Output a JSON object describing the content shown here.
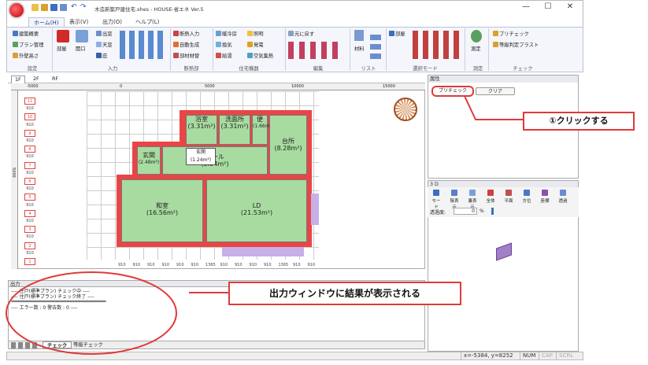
{
  "app": {
    "title": "木造新築戸建住宅.shes - HOUSE-省エネ Ver.5"
  },
  "window": {
    "minimize": "—",
    "maximize": "☐",
    "close": "✕"
  },
  "ribbon_tabs": [
    "ホーム(H)",
    "表示(V)",
    "出力(O)",
    "ヘルプ(L)"
  ],
  "ribbon": {
    "settings": {
      "label": "設定",
      "items": [
        "建築概要",
        "プラン管理",
        "外壁高さ"
      ]
    },
    "input": {
      "label": "入力",
      "room": "部屋",
      "opening": "開口",
      "col": [
        "出窓",
        "天窓",
        "庇"
      ]
    },
    "insulation": {
      "label": "断熱部",
      "items": [
        "断熱入力",
        "自動生成",
        "部材材替"
      ]
    },
    "equipment": {
      "label": "住宅機器",
      "items": [
        "暖冷房",
        "照明",
        "換気",
        "発電",
        "給湯",
        "空気集熱"
      ]
    },
    "edit": {
      "label": "編集",
      "items": [
        "元に戻す"
      ]
    },
    "list": {
      "label": "リスト",
      "items": [
        "材料"
      ]
    },
    "select_mode": {
      "label": "選択モード",
      "items": [
        "部屋"
      ]
    },
    "measure": {
      "label": "測定",
      "items": [
        "測定"
      ]
    },
    "check": {
      "label": "チェック",
      "items": [
        "プリチェック",
        "等級判定プラスト"
      ]
    }
  },
  "view_tabs": [
    "1F",
    "2F",
    "RF"
  ],
  "ruler": {
    "marks": [
      "-5000",
      "0",
      "5000",
      "10000",
      "15000"
    ],
    "left_label": "5000"
  },
  "levels": [
    "11",
    "910",
    "10",
    "910",
    "9",
    "910",
    "8",
    "910",
    "7",
    "910",
    "6",
    "910",
    "5",
    "910",
    "4",
    "910",
    "3",
    "910",
    "2",
    "910",
    "1"
  ],
  "bottom_dims": [
    "910",
    "910",
    "910",
    "910",
    "910",
    "910",
    "1365",
    "910",
    "910",
    "910",
    "910",
    "1365",
    "910",
    "910"
  ],
  "rooms": [
    {
      "name": "浴室",
      "area": "(3.31m²)"
    },
    {
      "name": "洗面所",
      "area": "(3.31m²)"
    },
    {
      "name": "便",
      "area": "(1.66m²)"
    },
    {
      "name": "台所",
      "area": "(8.28m²)"
    },
    {
      "name": "玄関",
      "area": "(2.48m²)"
    },
    {
      "name": "ホール",
      "area": "(9.94m²)"
    },
    {
      "name": "和室",
      "area": "(16.56m²)"
    },
    {
      "name": "LD",
      "area": "(21.53m²)"
    }
  ],
  "closet": {
    "name": "玄関",
    "area": "(1.24m²)"
  },
  "properties": {
    "title": "属性",
    "precheck": "プリチェック",
    "clear": "クリア"
  },
  "panel3d": {
    "title": "3 D",
    "tools": [
      "モード",
      "陰表示",
      "裏表示",
      "全体",
      "平面",
      "方位",
      "座標",
      "透過"
    ],
    "transparency_label": "透過度:",
    "transparency_value": "0",
    "percent": "%"
  },
  "output": {
    "title": "出力",
    "lines": [
      "---- 住戸(標準プラン) チェック中 ----",
      "---- 住戸(標準プラン) チェック終了 ----",
      "************************************************************",
      "---- エラー数 : 0 警告数 : 0 ----"
    ],
    "tabs": [
      "チェック",
      "等級チェック"
    ]
  },
  "status": {
    "coords": "x=-5384, y=8252",
    "num": "NUM",
    "cap": "CAP",
    "scrl": "SCRL"
  },
  "callouts": {
    "click": "①クリックする",
    "result": "出力ウィンドウに結果が表示される"
  }
}
